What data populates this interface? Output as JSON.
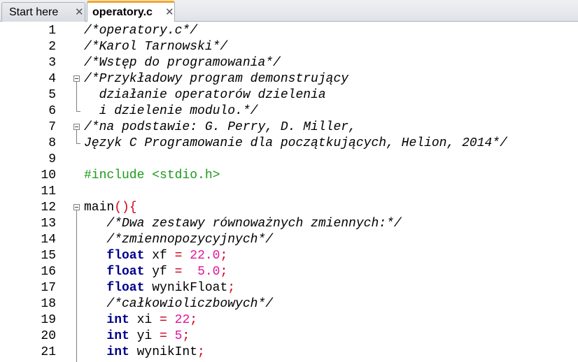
{
  "tabs": [
    {
      "label": "Start here",
      "close": "✕"
    },
    {
      "label": "operatory.c",
      "close": "✕"
    }
  ],
  "lines": [
    {
      "n": "1",
      "tokens": [
        {
          "t": "/*operatory.c*/",
          "c": "com"
        }
      ]
    },
    {
      "n": "2",
      "tokens": [
        {
          "t": "/*Karol Tarnowski*/",
          "c": "com"
        }
      ]
    },
    {
      "n": "3",
      "tokens": [
        {
          "t": "/*Wstęp do programowania*/",
          "c": "com"
        }
      ]
    },
    {
      "n": "4",
      "tokens": [
        {
          "t": "/*Przykładowy program demonstrujący",
          "c": "com"
        }
      ]
    },
    {
      "n": "5",
      "tokens": [
        {
          "t": "  działanie operatorów dzielenia",
          "c": "com"
        }
      ]
    },
    {
      "n": "6",
      "tokens": [
        {
          "t": "  i dzielenie modulo.*/",
          "c": "com"
        }
      ]
    },
    {
      "n": "7",
      "tokens": [
        {
          "t": "/*na podstawie: G. Perry, D. Miller,",
          "c": "com"
        }
      ]
    },
    {
      "n": "8",
      "tokens": [
        {
          "t": "Język C Programowanie dla początkujących, Helion, 2014*/",
          "c": "com"
        }
      ]
    },
    {
      "n": "9",
      "tokens": []
    },
    {
      "n": "10",
      "tokens": [
        {
          "t": "#include <stdio.h>",
          "c": "pre"
        }
      ]
    },
    {
      "n": "11",
      "tokens": []
    },
    {
      "n": "12",
      "tokens": [
        {
          "t": "main",
          "c": "txt"
        },
        {
          "t": "(){",
          "c": "op"
        }
      ]
    },
    {
      "n": "13",
      "tokens": [
        {
          "t": "   /*Dwa zestawy równoważnych zmiennych:*/",
          "c": "com"
        }
      ]
    },
    {
      "n": "14",
      "tokens": [
        {
          "t": "   /*zmiennopozycyjnych*/",
          "c": "com"
        }
      ]
    },
    {
      "n": "15",
      "tokens": [
        {
          "t": "   ",
          "c": "txt"
        },
        {
          "t": "float",
          "c": "kw"
        },
        {
          "t": " xf ",
          "c": "txt"
        },
        {
          "t": "=",
          "c": "op"
        },
        {
          "t": " ",
          "c": "txt"
        },
        {
          "t": "22.0",
          "c": "num"
        },
        {
          "t": ";",
          "c": "op"
        }
      ]
    },
    {
      "n": "16",
      "tokens": [
        {
          "t": "   ",
          "c": "txt"
        },
        {
          "t": "float",
          "c": "kw"
        },
        {
          "t": " yf ",
          "c": "txt"
        },
        {
          "t": "=",
          "c": "op"
        },
        {
          "t": "  ",
          "c": "txt"
        },
        {
          "t": "5.0",
          "c": "num"
        },
        {
          "t": ";",
          "c": "op"
        }
      ]
    },
    {
      "n": "17",
      "tokens": [
        {
          "t": "   ",
          "c": "txt"
        },
        {
          "t": "float",
          "c": "kw"
        },
        {
          "t": " wynikFloat",
          "c": "txt"
        },
        {
          "t": ";",
          "c": "op"
        }
      ]
    },
    {
      "n": "18",
      "tokens": [
        {
          "t": "   /*całkowioliczbowych*/",
          "c": "com"
        }
      ]
    },
    {
      "n": "19",
      "tokens": [
        {
          "t": "   ",
          "c": "txt"
        },
        {
          "t": "int",
          "c": "kw"
        },
        {
          "t": " xi ",
          "c": "txt"
        },
        {
          "t": "=",
          "c": "op"
        },
        {
          "t": " ",
          "c": "txt"
        },
        {
          "t": "22",
          "c": "num"
        },
        {
          "t": ";",
          "c": "op"
        }
      ]
    },
    {
      "n": "20",
      "tokens": [
        {
          "t": "   ",
          "c": "txt"
        },
        {
          "t": "int",
          "c": "kw"
        },
        {
          "t": " yi ",
          "c": "txt"
        },
        {
          "t": "=",
          "c": "op"
        },
        {
          "t": " ",
          "c": "txt"
        },
        {
          "t": "5",
          "c": "num"
        },
        {
          "t": ";",
          "c": "op"
        }
      ]
    },
    {
      "n": "21",
      "tokens": [
        {
          "t": "   ",
          "c": "txt"
        },
        {
          "t": "int",
          "c": "kw"
        },
        {
          "t": " wynikInt",
          "c": "txt"
        },
        {
          "t": ";",
          "c": "op"
        }
      ]
    }
  ],
  "colors": {
    "comment": "#000000",
    "preprocessor": "#1d9a1d",
    "keyword": "#00008b",
    "number": "#e0169a",
    "operator": "#d0001a",
    "active_tab_accent": "#f3a52a"
  }
}
